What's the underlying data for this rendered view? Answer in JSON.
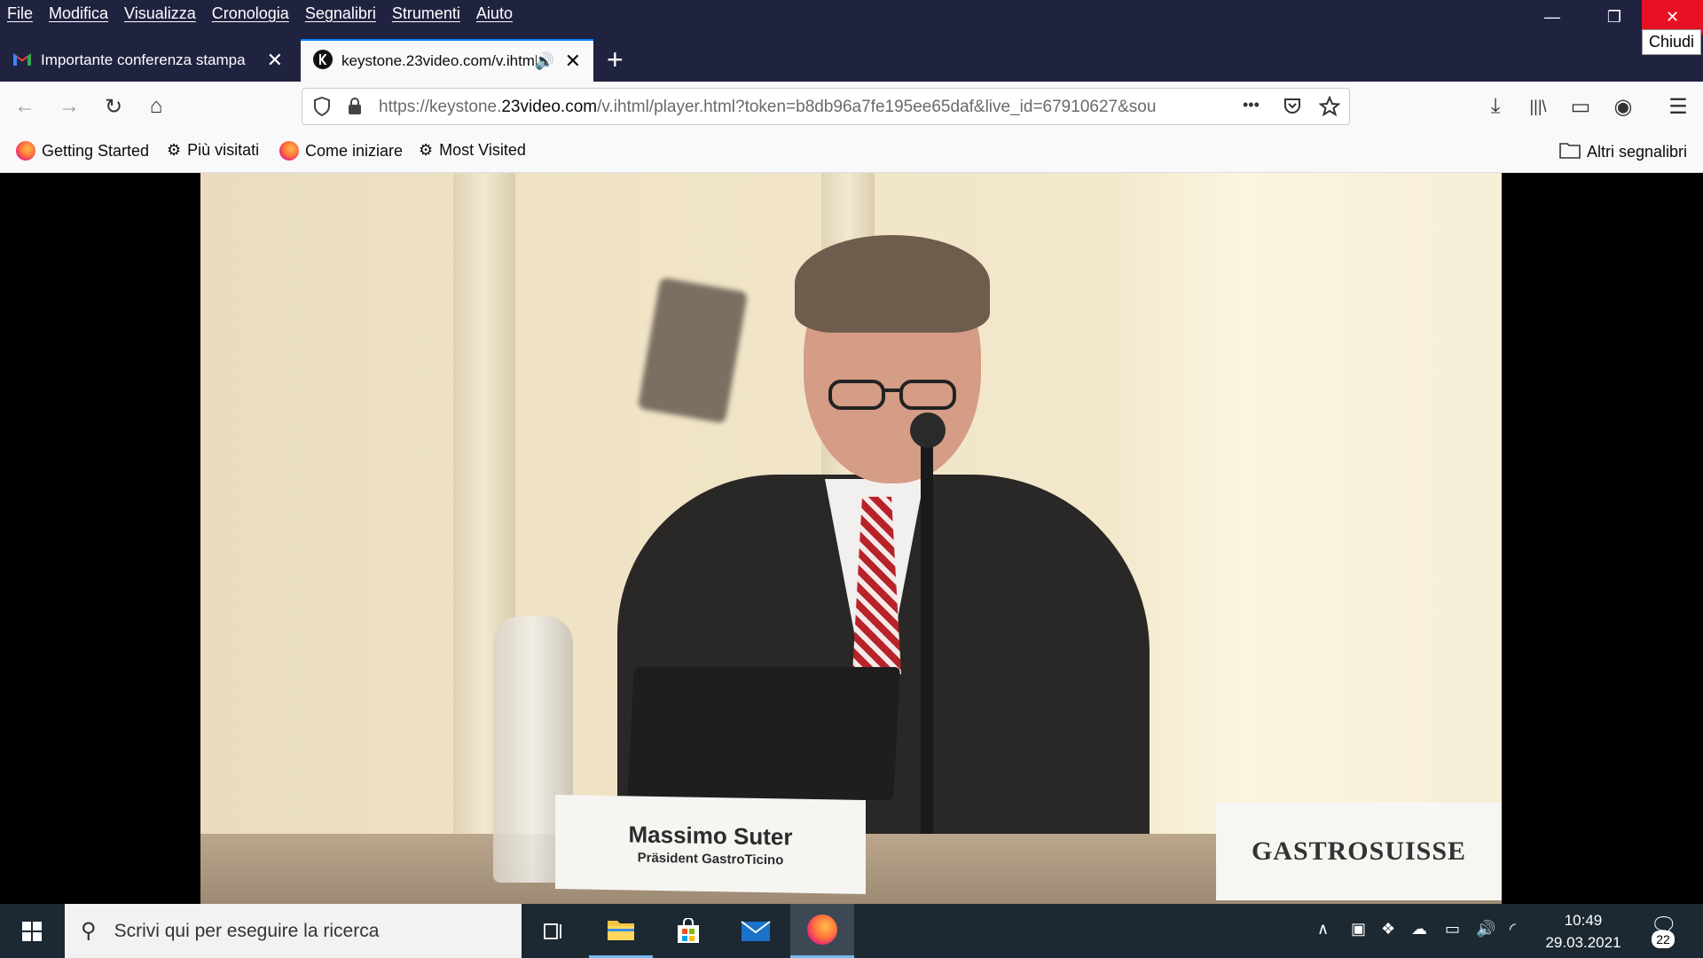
{
  "menu": [
    "File",
    "Modifica",
    "Visualizza",
    "Cronologia",
    "Segnalibri",
    "Strumenti",
    "Aiuto"
  ],
  "window": {
    "close_tooltip": "Chiudi",
    "min_symbol": "—",
    "max_symbol": "❐",
    "close_symbol": "✕"
  },
  "tabs": [
    {
      "title": "Importante conferenza stampa",
      "close": "✕"
    },
    {
      "title": "keystone.23video.com/v.ihtml",
      "close": "✕",
      "audio": "🔊"
    }
  ],
  "newtab": "+",
  "nav": {
    "back": "←",
    "forward": "→",
    "reload": "↻",
    "home": "⌂",
    "url_prefix": "https://keystone.",
    "url_domain": "23video.com",
    "url_suffix": "/v.ihtml/player.html?token=b8db96a7fe195ee65daf&live_id=67910627&sou",
    "page_actions": "•••",
    "download": "⤓",
    "library": "|||\\",
    "sidebar": "▭",
    "account": "◉",
    "hamburger": "☰"
  },
  "bookmarks": [
    "Getting Started",
    "Più visitati",
    "Come iniziare",
    "Most Visited"
  ],
  "bookmarks_other": "Altri segnalibri",
  "video": {
    "nameplate_name": "Massimo Suter",
    "nameplate_role": "Präsident GastroTicino",
    "logo_text": "GASTROSUISSE"
  },
  "taskbar": {
    "search_placeholder": "Scrivi qui per eseguire la ricerca",
    "time": "10:49",
    "date": "29.03.2021",
    "notifications": "22"
  }
}
